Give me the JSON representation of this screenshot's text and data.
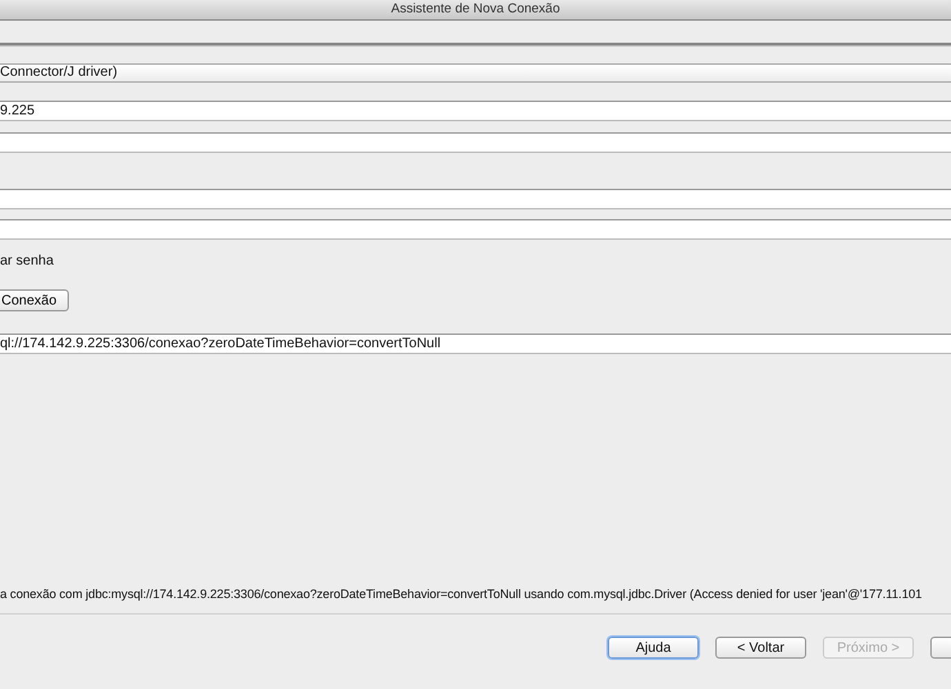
{
  "window": {
    "title": "Assistente de Nova Conexão"
  },
  "driver_field": {
    "value": "Connector/J driver)"
  },
  "host_field": {
    "value": "9.225"
  },
  "remember_password": {
    "label": "ar senha"
  },
  "test_button": {
    "label": "Conexão"
  },
  "url_field": {
    "value": "ql://174.142.9.225:3306/conexao?zeroDateTimeBehavior=convertToNull"
  },
  "error_message": "a conexão com jdbc:mysql://174.142.9.225:3306/conexao?zeroDateTimeBehavior=convertToNull usando com.mysql.jdbc.Driver (Access denied for user 'jean'@'177.11.101",
  "buttons": [
    {
      "label": "Ajuda",
      "disabled": false,
      "focused": true
    },
    {
      "label": "< Voltar",
      "disabled": false,
      "focused": false
    },
    {
      "label": "Próximo >",
      "disabled": true,
      "focused": false
    }
  ]
}
